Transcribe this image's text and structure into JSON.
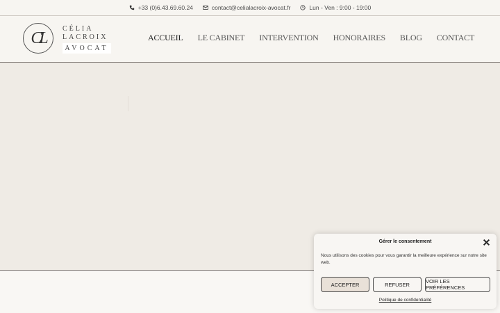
{
  "topbar": {
    "phone": "+33 (0)6.43.69.60.24",
    "email": "contact@celialacroix-avocat.fr",
    "hours": "Lun - Ven : 9:00 - 19:00",
    "icons": [
      "phone-icon",
      "envelope-icon",
      "clock-icon"
    ]
  },
  "logo": {
    "monogram": "CL",
    "line1": "CÉLIA",
    "line2": "LACROIX",
    "line3": "AVOCAT"
  },
  "nav": {
    "items": [
      {
        "label": "ACCUEIL"
      },
      {
        "label": "LE CABINET"
      },
      {
        "label": "INTERVENTION"
      },
      {
        "label": "HONORAIRES"
      },
      {
        "label": "BLOG"
      },
      {
        "label": "CONTACT"
      }
    ],
    "active_index": 0
  },
  "cookie": {
    "title": "Gérer le consentement",
    "text": "Nous utilisons des cookies pour vous garantir la meilleure expérience sur notre site web.",
    "accept_label": "ACCEPTER",
    "refuse_label": "REFUSER",
    "prefs_label": "VOIR LES PRÉFÉRENCES",
    "policy_link": "Politique de confidentialité"
  },
  "colors": {
    "page_bg": "#f7f5f1",
    "hero_bg": "#efebe5",
    "accept_bg": "#e9e1d8"
  }
}
